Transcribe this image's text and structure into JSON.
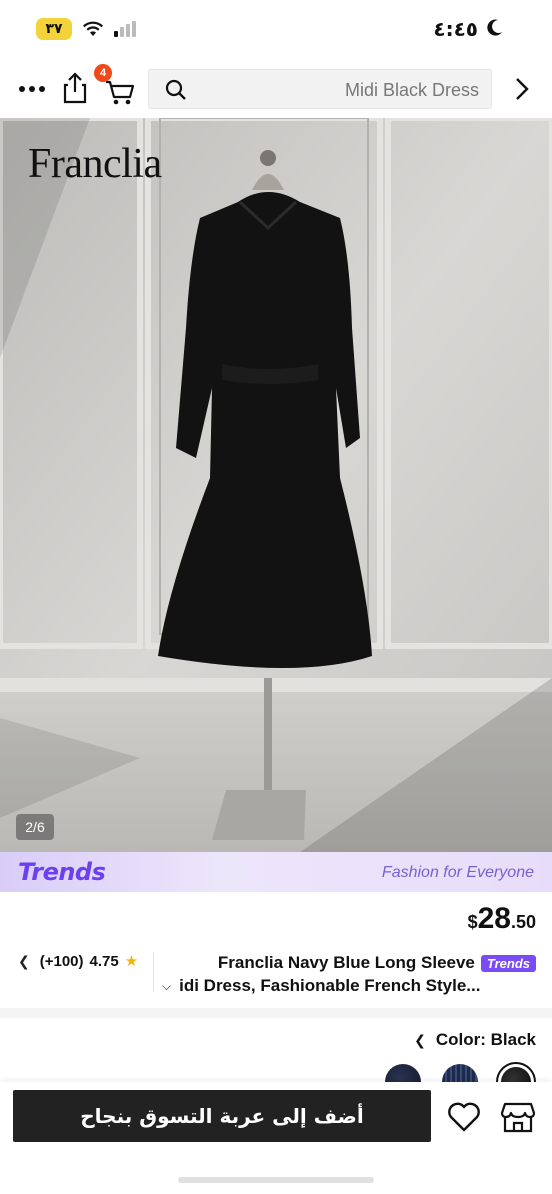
{
  "status_bar": {
    "battery": "٣٧",
    "time": "٤:٤٥"
  },
  "nav": {
    "cart_count": "4",
    "search_placeholder": "Midi Black Dress"
  },
  "gallery": {
    "brand": "Franclia",
    "counter": "2/6"
  },
  "banner": {
    "logo": "Trends",
    "tagline": "Fashion for Everyone"
  },
  "product": {
    "price_currency": "$",
    "price_main": "28",
    "price_cents": ".50",
    "rating": "4.75",
    "reviews": "(+100)",
    "title_line1": "Franclia Navy Blue Long Sleeve",
    "trends_tag": "Trends",
    "title_line2": "idi Dress, Fashionable French Style..."
  },
  "color": {
    "label": "Color: Black"
  },
  "bottom_bar": {
    "add_to_cart": "أضف إلى عربة التسوق بنجاح"
  }
}
